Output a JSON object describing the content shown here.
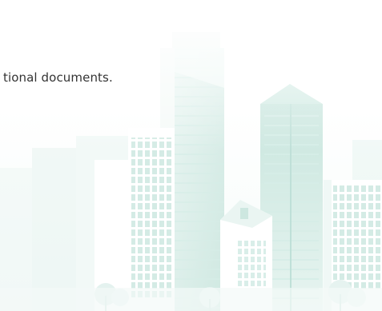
{
  "caption": {
    "text": "tional documents."
  },
  "illustration": {
    "subject": "city-skyline",
    "colors": {
      "teal_light": "#dcefeb",
      "teal_mid": "#c3e3dc",
      "teal_dark": "#a8d6cc",
      "white": "#ffffff",
      "window": "#d8ece7",
      "glass": "#e6f4f1"
    }
  }
}
